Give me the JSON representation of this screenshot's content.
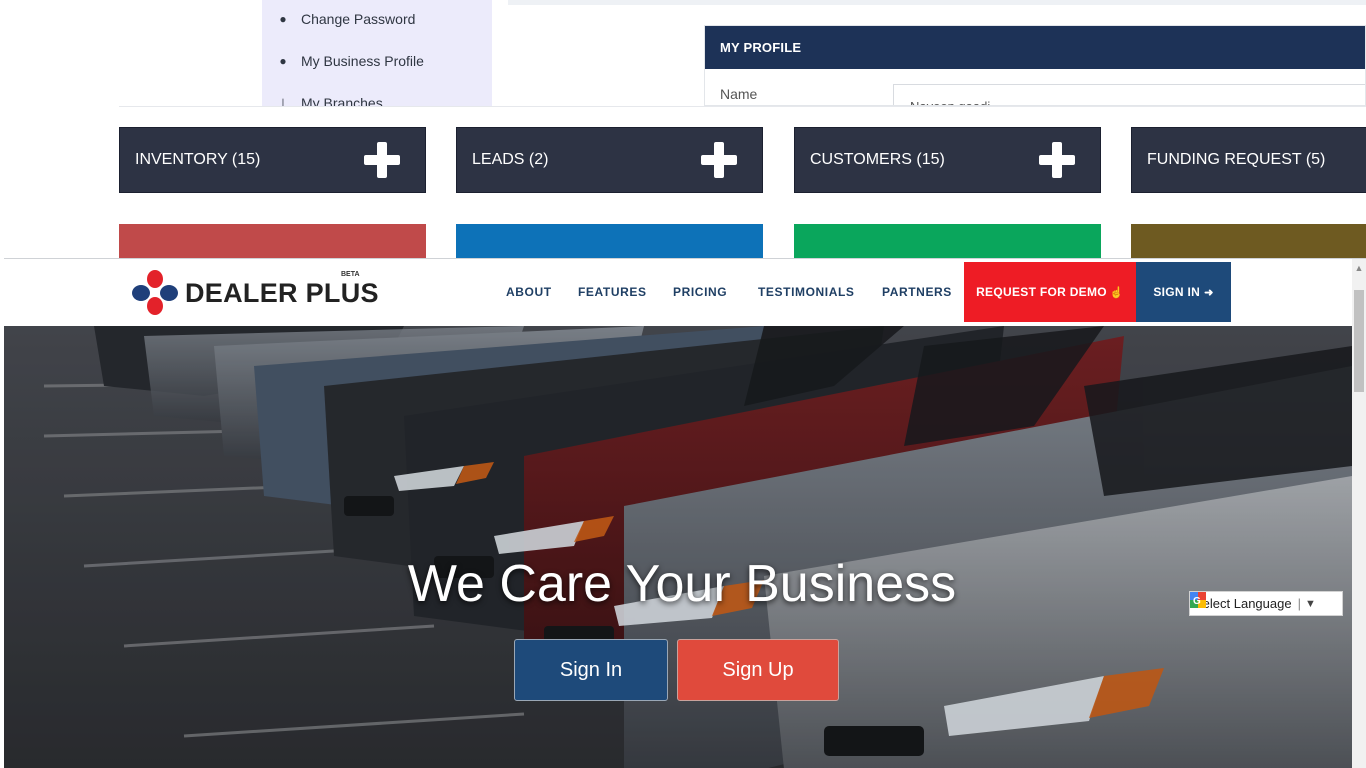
{
  "dashboard": {
    "menu": [
      {
        "label": "Change Password",
        "icon": "user-icon"
      },
      {
        "label": "My Business Profile",
        "icon": "user-icon"
      },
      {
        "label": "My Branches",
        "icon": "sitemap-icon"
      }
    ],
    "profile": {
      "title": "MY PROFILE",
      "name_label": "Name",
      "name_value": "Naveen gaadi"
    },
    "stats": [
      {
        "label": "INVENTORY (15)",
        "color": "#c04a4a"
      },
      {
        "label": "LEADS (2)",
        "color": "#0d72b8"
      },
      {
        "label": "CUSTOMERS (15)",
        "color": "#0aa65c"
      },
      {
        "label": "FUNDING REQUEST (5)",
        "color": "#6e5a21"
      }
    ]
  },
  "site": {
    "logo": {
      "text": "DEALER PLUS",
      "badge": "BETA"
    },
    "nav": {
      "about": "ABOUT",
      "features": "FEATURES",
      "pricing": "PRICING",
      "testimonials": "TESTIMONIALS",
      "partners": "PARTNERS",
      "demo": "REQUEST FOR DEMO",
      "signin": "SIGN IN"
    },
    "hero": {
      "title": "We Care Your Business",
      "signin_button": "Sign In",
      "signup_button": "Sign Up"
    },
    "translate": {
      "label": "Select Language",
      "separator": "|",
      "arrow": "▼"
    },
    "colors": {
      "brand_blue": "#1e4a7a",
      "brand_red": "#ee1c25",
      "signup_red": "#e04a3c"
    }
  }
}
